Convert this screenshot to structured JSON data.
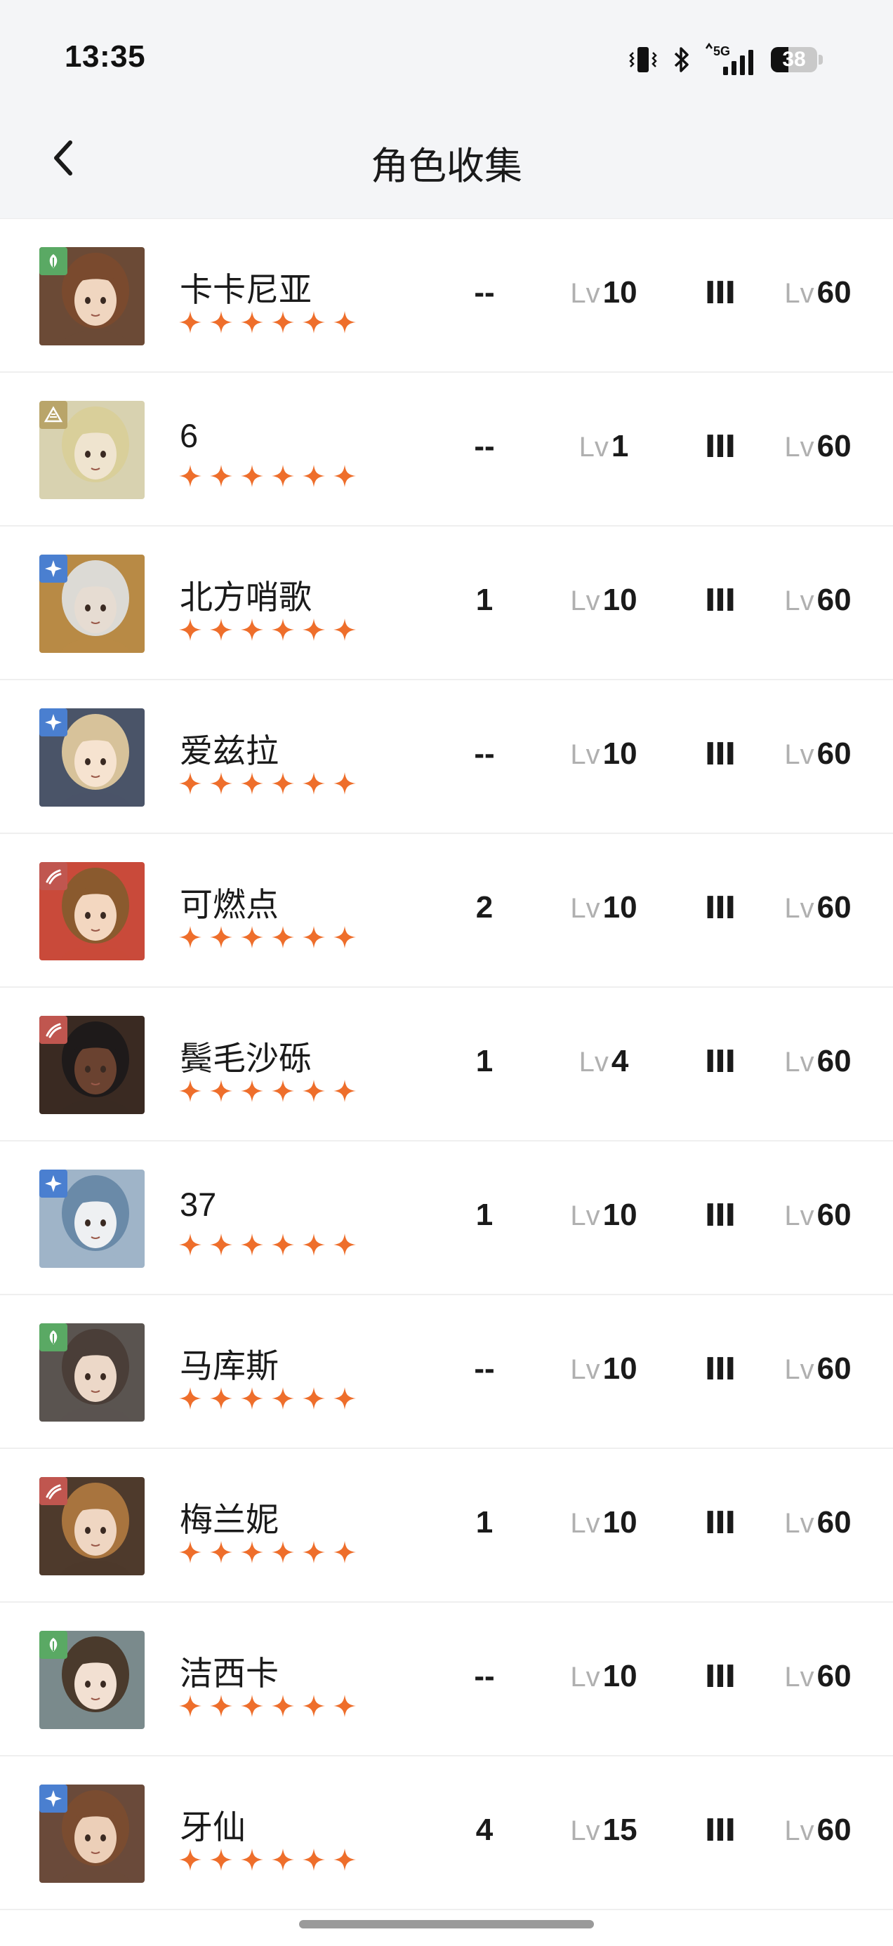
{
  "status_bar": {
    "time": "13:35",
    "network": "5G",
    "battery": "38",
    "battery_level": 0.38
  },
  "header": {
    "title": "角色收集",
    "back_icon": "chevron-left-icon"
  },
  "colors": {
    "star": "#ee6e2b",
    "badge_nature": "#5aa964",
    "badge_earth": "#b9a56a",
    "badge_star": "#4a7fd0",
    "badge_beast": "#c0564f"
  },
  "characters": [
    {
      "name": "卡卡尼亚",
      "badge": "nature",
      "stars": 6,
      "stat": "--",
      "lv_label": "Lv",
      "level": "10",
      "rank": "III",
      "max_label": "Lv",
      "max_level": "60",
      "tone": "#6b4a36",
      "skin": "#f0d6c0",
      "hair": "#7a4a2e"
    },
    {
      "name": "6",
      "badge": "earth",
      "stars": 6,
      "stat": "--",
      "lv_label": "Lv",
      "level": "1",
      "rank": "III",
      "max_label": "Lv",
      "max_level": "60",
      "tone": "#d8d2b0",
      "skin": "#efe4cf",
      "hair": "#d9cf9a"
    },
    {
      "name": "北方哨歌",
      "badge": "star",
      "stars": 6,
      "stat": "1",
      "lv_label": "Lv",
      "level": "10",
      "rank": "III",
      "max_label": "Lv",
      "max_level": "60",
      "tone": "#b88a45",
      "skin": "#e6dcd2",
      "hair": "#dcdad5"
    },
    {
      "name": "爱兹拉",
      "badge": "star",
      "stars": 6,
      "stat": "--",
      "lv_label": "Lv",
      "level": "10",
      "rank": "III",
      "max_label": "Lv",
      "max_level": "60",
      "tone": "#4a5468",
      "skin": "#f6e3d0",
      "hair": "#d7c29a"
    },
    {
      "name": "可燃点",
      "badge": "beast",
      "stars": 6,
      "stat": "2",
      "lv_label": "Lv",
      "level": "10",
      "rank": "III",
      "max_label": "Lv",
      "max_level": "60",
      "tone": "#c94a3a",
      "skin": "#f3d7c0",
      "hair": "#8a5a2e"
    },
    {
      "name": "鬓毛沙砾",
      "badge": "beast",
      "stars": 6,
      "stat": "1",
      "lv_label": "Lv",
      "level": "4",
      "rank": "III",
      "max_label": "Lv",
      "max_level": "60",
      "tone": "#3a2a22",
      "skin": "#6a4230",
      "hair": "#1e1a1a"
    },
    {
      "name": "37",
      "badge": "star",
      "stars": 6,
      "stat": "1",
      "lv_label": "Lv",
      "level": "10",
      "rank": "III",
      "max_label": "Lv",
      "max_level": "60",
      "tone": "#9fb4c8",
      "skin": "#eef0f2",
      "hair": "#6a8aa8"
    },
    {
      "name": "马库斯",
      "badge": "nature",
      "stars": 6,
      "stat": "--",
      "lv_label": "Lv",
      "level": "10",
      "rank": "III",
      "max_label": "Lv",
      "max_level": "60",
      "tone": "#5a5450",
      "skin": "#ecd8c8",
      "hair": "#4a3e38"
    },
    {
      "name": "梅兰妮",
      "badge": "beast",
      "stars": 6,
      "stat": "1",
      "lv_label": "Lv",
      "level": "10",
      "rank": "III",
      "max_label": "Lv",
      "max_level": "60",
      "tone": "#4e3a2c",
      "skin": "#efd6c2",
      "hair": "#a8743e"
    },
    {
      "name": "洁西卡",
      "badge": "nature",
      "stars": 6,
      "stat": "--",
      "lv_label": "Lv",
      "level": "10",
      "rank": "III",
      "max_label": "Lv",
      "max_level": "60",
      "tone": "#7a8a8c",
      "skin": "#f2e0d2",
      "hair": "#4a3a2c"
    },
    {
      "name": "牙仙",
      "badge": "star",
      "stars": 6,
      "stat": "4",
      "lv_label": "Lv",
      "level": "15",
      "rank": "III",
      "max_label": "Lv",
      "max_level": "60",
      "tone": "#6a4a3a",
      "skin": "#eccfb8",
      "hair": "#7a4c30"
    }
  ]
}
